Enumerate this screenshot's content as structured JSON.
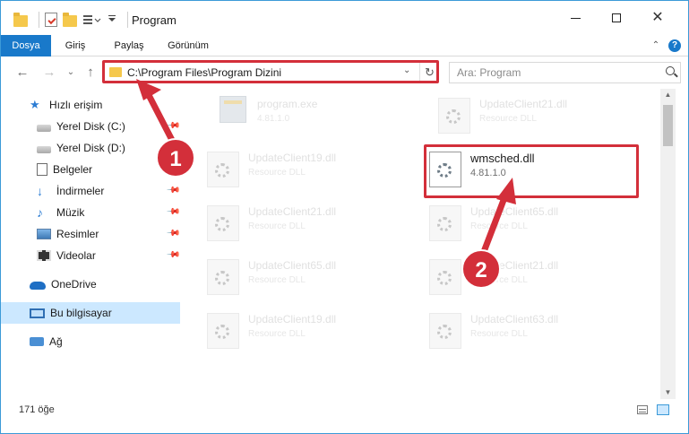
{
  "window": {
    "title": "Program",
    "minimize_glyph": "",
    "close_glyph": "✕"
  },
  "ribbon": {
    "tabs": [
      "Dosya",
      "Giriş",
      "Paylaş",
      "Görünüm"
    ],
    "collapse_glyph": "⌃",
    "help_glyph": "?"
  },
  "nav": {
    "back_glyph": "←",
    "forward_glyph": "→",
    "recent_glyph": "⌄",
    "up_glyph": "↑",
    "path": "C:\\Program Files\\Program Dizini",
    "dropdown_glyph": "⌄",
    "refresh_glyph": "↻"
  },
  "search": {
    "placeholder": "Ara: Program"
  },
  "sidebar": {
    "items": [
      {
        "label": "Hızlı erişim",
        "icon": "star-icon",
        "pinned": false
      },
      {
        "label": "Yerel Disk (C:)",
        "icon": "disk-icon",
        "pinned": true
      },
      {
        "label": "Yerel Disk (D:)",
        "icon": "disk-icon",
        "pinned": true
      },
      {
        "label": "Belgeler",
        "icon": "document-icon",
        "pinned": true
      },
      {
        "label": "İndirmeler",
        "icon": "download-icon",
        "pinned": true
      },
      {
        "label": "Müzik",
        "icon": "music-icon",
        "pinned": true
      },
      {
        "label": "Resimler",
        "icon": "pictures-icon",
        "pinned": true
      },
      {
        "label": "Videolar",
        "icon": "video-icon",
        "pinned": true
      },
      {
        "label": "OneDrive",
        "icon": "cloud-icon",
        "pinned": false
      },
      {
        "label": "Bu bilgisayar",
        "icon": "computer-icon",
        "pinned": false,
        "selected": true
      },
      {
        "label": "Ağ",
        "icon": "network-icon",
        "pinned": false
      }
    ],
    "pin_glyph": "📌"
  },
  "files": [
    {
      "name": "program.exe",
      "type": "4.81.1.0",
      "icon": "exe-icon"
    },
    {
      "name": "UpdateClient21.dll",
      "type": "Resource DLL",
      "icon": "dll-icon"
    },
    {
      "name": "UpdateClient19.dll",
      "type": "Resource DLL",
      "icon": "dll-icon"
    },
    {
      "name": "wmsched.dll",
      "type": "4.81.1.0",
      "icon": "dll-icon",
      "highlighted": true
    },
    {
      "name": "UpdateClient21.dll",
      "type": "Resource DLL",
      "icon": "dll-icon"
    },
    {
      "name": "UpdateClient65.dll",
      "type": "Resource DLL",
      "icon": "dll-icon"
    },
    {
      "name": "UpdateClient65.dll",
      "type": "Resource DLL",
      "icon": "dll-icon"
    },
    {
      "name": "UpdateClient21.dll",
      "type": "Resource DLL",
      "icon": "dll-icon"
    },
    {
      "name": "UpdateClient19.dll",
      "type": "Resource DLL",
      "icon": "dll-icon"
    },
    {
      "name": "UpdateClient63.dll",
      "type": "Resource DLL",
      "icon": "dll-icon"
    }
  ],
  "scrollbar": {
    "up_glyph": "▲",
    "down_glyph": "▼"
  },
  "status": {
    "item_count": "171 öğe"
  },
  "annotations": {
    "badges": [
      "1",
      "2"
    ],
    "color": "#d32f3a"
  },
  "colors": {
    "accent": "#1979ca",
    "selection": "#cce8ff",
    "annotation": "#d32f3a"
  }
}
